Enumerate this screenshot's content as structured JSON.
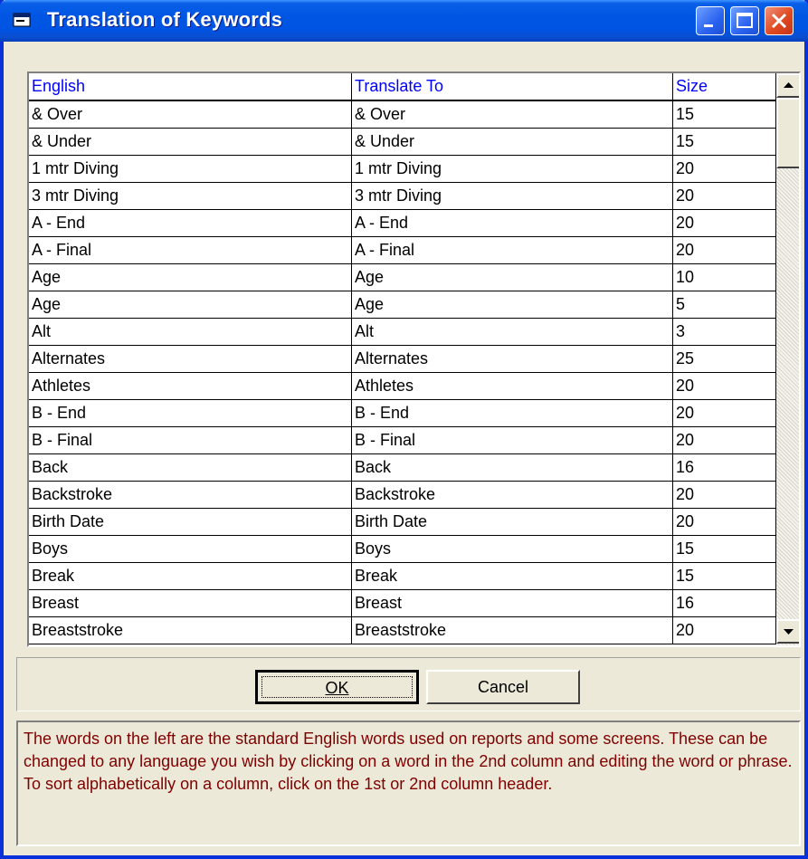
{
  "window": {
    "title": "Translation of Keywords"
  },
  "grid": {
    "headers": [
      "English",
      "Translate To",
      "Size"
    ],
    "rows": [
      [
        "& Over",
        "& Over",
        "15"
      ],
      [
        "& Under",
        "& Under",
        "15"
      ],
      [
        "1 mtr Diving",
        "1 mtr Diving",
        "20"
      ],
      [
        "3 mtr Diving",
        "3 mtr Diving",
        "20"
      ],
      [
        "A - End",
        "A - End",
        "20"
      ],
      [
        "A - Final",
        "A - Final",
        "20"
      ],
      [
        "Age",
        "Age",
        "10"
      ],
      [
        "Age",
        "Age",
        "5"
      ],
      [
        "Alt",
        "Alt",
        "3"
      ],
      [
        "Alternates",
        "Alternates",
        "25"
      ],
      [
        "Athletes",
        "Athletes",
        "20"
      ],
      [
        "B - End",
        "B - End",
        "20"
      ],
      [
        "B - Final",
        "B - Final",
        "20"
      ],
      [
        "Back",
        "Back",
        "16"
      ],
      [
        "Backstroke",
        "Backstroke",
        "20"
      ],
      [
        "Birth Date",
        "Birth Date",
        "20"
      ],
      [
        "Boys",
        "Boys",
        "15"
      ],
      [
        "Break",
        "Break",
        "15"
      ],
      [
        "Breast",
        "Breast",
        "16"
      ],
      [
        "Breaststroke",
        "Breaststroke",
        "20"
      ]
    ]
  },
  "buttons": {
    "ok": "OK",
    "cancel": "Cancel"
  },
  "help": "The words on the left are the standard English words used on reports and some screens. These can be changed to any language you wish by clicking on a word in the 2nd column and editing the word or phrase. To sort alphabetically on a column, click on the 1st or 2nd column header.",
  "colors": {
    "title_bar": "#0054e3",
    "header_text": "#0000ff",
    "help_text": "#800000"
  }
}
